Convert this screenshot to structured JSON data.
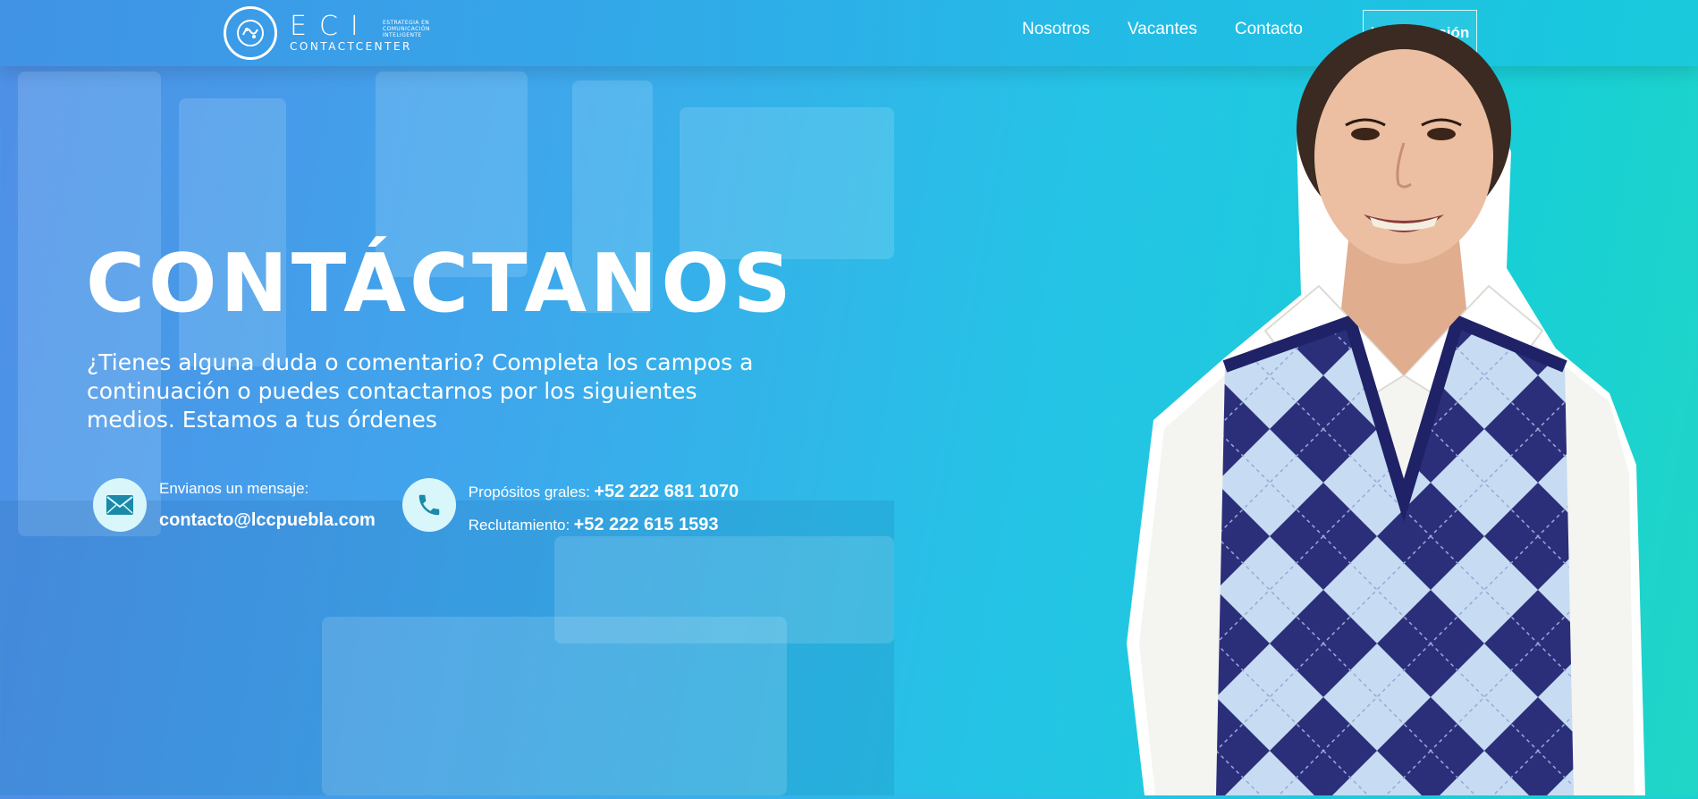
{
  "header": {
    "logo_mark": "ECI",
    "logo_sub": "CONTACTCENTER",
    "logo_tagline": "ESTRATEGIA EN COMUNICACIÓN INTELIGENTE",
    "nav": [
      "Nosotros",
      "Vacantes",
      "Contacto"
    ],
    "login_label": "Iniciar Sesión"
  },
  "hero": {
    "title": "CONTÁCTANOS",
    "description": "¿Tienes alguna duda o comentario? Completa los campos a continuación o puedes contactarnos por los siguientes medios. Estamos a tus órdenes"
  },
  "contact": {
    "email_label": "Envianos un mensaje:",
    "email_value": "contacto@lccpuebla.com",
    "phones": [
      {
        "label": "Propósitos grales:",
        "value": "+52 222 681 1070"
      },
      {
        "label": "Reclutamiento:",
        "value": "+52 222 615 1593"
      }
    ]
  },
  "icons": {
    "logo": "logo-emblem-icon",
    "email": "envelope-icon",
    "phone": "phone-icon"
  },
  "colors": {
    "accent_teal": "#18cfd6",
    "accent_blue": "#4f8fe6",
    "icon_circle": "#d9f7fb",
    "icon_glyph": "#1a8aa8",
    "vest_navy": "#2b2f7a",
    "vest_light": "#c7dcf2"
  }
}
